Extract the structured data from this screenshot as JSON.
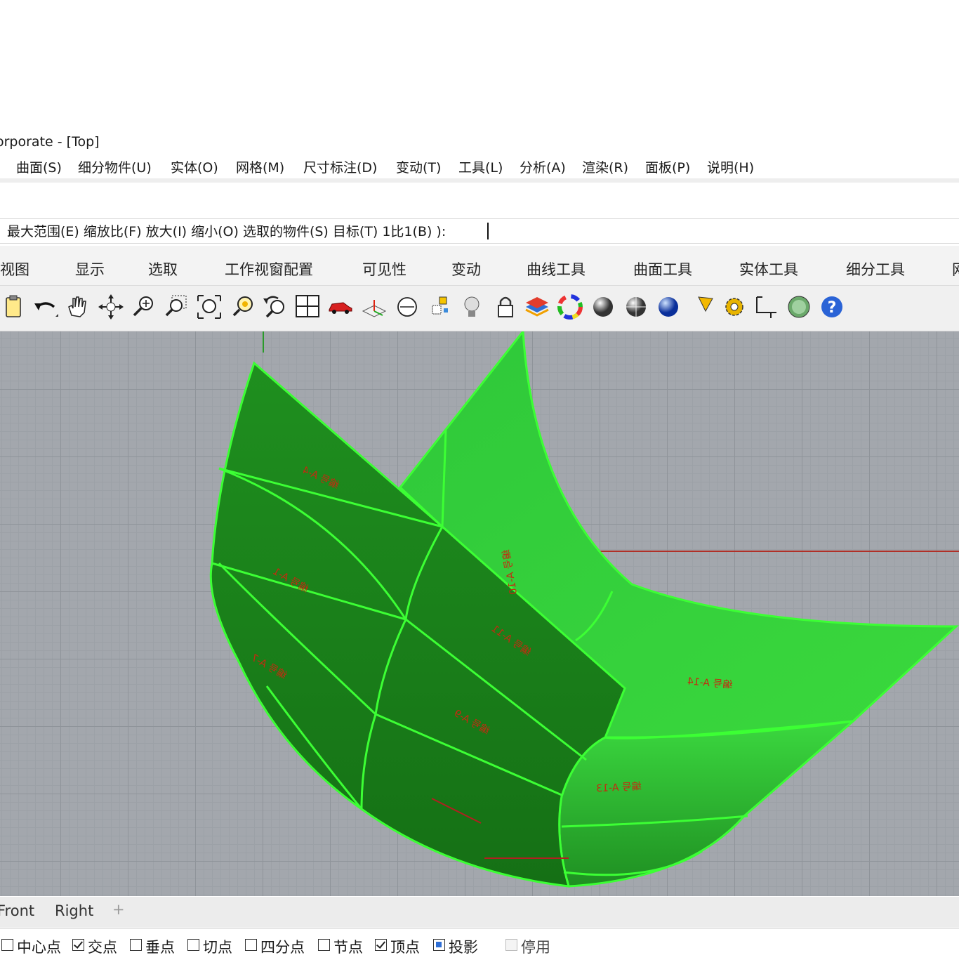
{
  "window": {
    "title": "orporate - [Top]"
  },
  "menu": [
    "曲面(S)",
    "细分物件(U)",
    "实体(O)",
    "网格(M)",
    "尺寸标注(D)",
    "变动(T)",
    "工具(L)",
    "分析(A)",
    "渲染(R)",
    "面板(P)",
    "说明(H)"
  ],
  "command": {
    "prompt": "最大范围(E)  缩放比(F)  放大(I)  缩小(O)  选取的物件(S)  目标(T)  1比1(B) ):"
  },
  "toolbar_tabs": [
    "视图",
    "显示",
    "选取",
    "工作视窗配置",
    "可见性",
    "变动",
    "曲线工具",
    "曲面工具",
    "实体工具",
    "细分工具",
    "网"
  ],
  "toolbar_icons": [
    "clipboard-icon",
    "undo-icon",
    "pan-hand-icon",
    "rotate-view-icon",
    "zoom-icon",
    "zoom-window-icon",
    "zoom-extents-icon",
    "zoom-selected-icon",
    "undo-view-icon",
    "four-viewports-icon",
    "car-icon",
    "cplane-icon",
    "snapshot-icon",
    "named-position-icon",
    "light-bulb-icon",
    "lock-icon",
    "layer-icon",
    "color-wheel-icon",
    "shaded-sphere-icon",
    "ghosted-sphere-icon",
    "rendered-sphere-icon",
    "light-icon",
    "options-gear-icon",
    "dimension-icon",
    "environment-icon",
    "help-icon"
  ],
  "surface_labels": [
    "编号 A-4",
    "编号 A-10",
    "编号 A-1",
    "编号 A-11",
    "编号 A-7",
    "编号 A-14",
    "编号 A-9",
    "编号 A-13"
  ],
  "viewport_tabs": [
    "Front",
    "Right"
  ],
  "viewport_tab_add_icon": "plus-icon",
  "osnap": [
    {
      "label": "中心点",
      "state": "unchecked"
    },
    {
      "label": "交点",
      "state": "checked"
    },
    {
      "label": "垂点",
      "state": "unchecked"
    },
    {
      "label": "切点",
      "state": "unchecked"
    },
    {
      "label": "四分点",
      "state": "unchecked"
    },
    {
      "label": "节点",
      "state": "unchecked"
    },
    {
      "label": "顶点",
      "state": "checked"
    },
    {
      "label": "投影",
      "state": "filled"
    },
    {
      "label": "停用",
      "state": "disabled"
    }
  ],
  "colors": {
    "surface_dark": "#1f8c1f",
    "surface_light": "#37d33b",
    "edge": "#3cff34",
    "axis_x": "#b03028",
    "axis_y": "#2a9a2a"
  }
}
